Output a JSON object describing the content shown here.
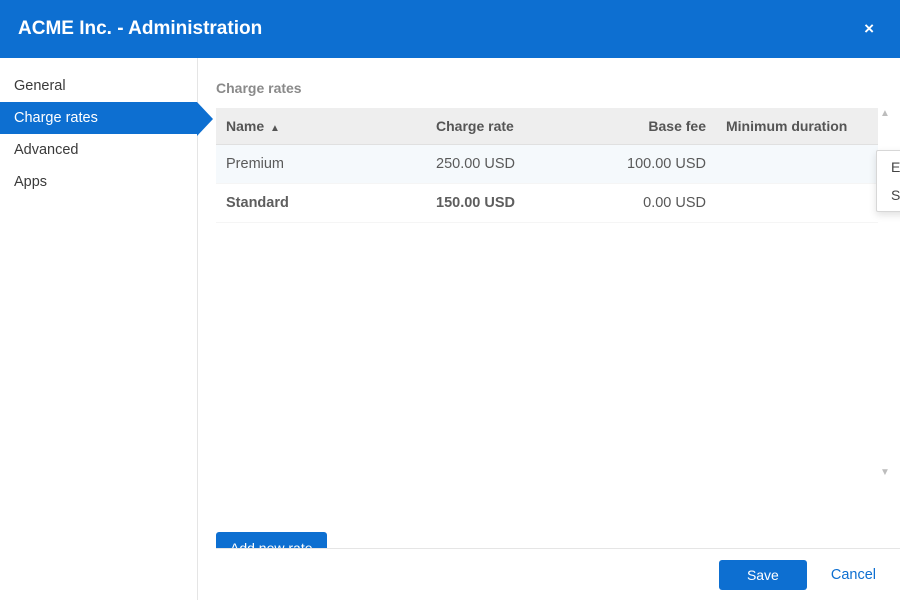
{
  "header": {
    "title": "ACME Inc. - Administration",
    "close_icon": "×"
  },
  "sidebar": {
    "items": [
      {
        "label": "General"
      },
      {
        "label": "Charge rates"
      },
      {
        "label": "Advanced"
      },
      {
        "label": "Apps"
      }
    ],
    "active_index": 1
  },
  "main": {
    "section_title": "Charge rates",
    "columns": {
      "name": "Name",
      "rate": "Charge rate",
      "base": "Base fee",
      "min": "Minimum duration"
    },
    "sort_indicator": "▲",
    "rows": [
      {
        "name": "Premium",
        "rate": "250.00 USD",
        "base": "100.00 USD",
        "min": ""
      },
      {
        "name": "Standard",
        "rate": "150.00 USD",
        "base": "0.00 USD",
        "min": ""
      }
    ],
    "row_menu": {
      "edit": "Edit settings",
      "default": "Set to default"
    },
    "gear_caret": "▼",
    "add_button": "Add new rate",
    "scroll_up": "▲",
    "scroll_down": "▼"
  },
  "footer": {
    "save": "Save",
    "cancel": "Cancel"
  }
}
